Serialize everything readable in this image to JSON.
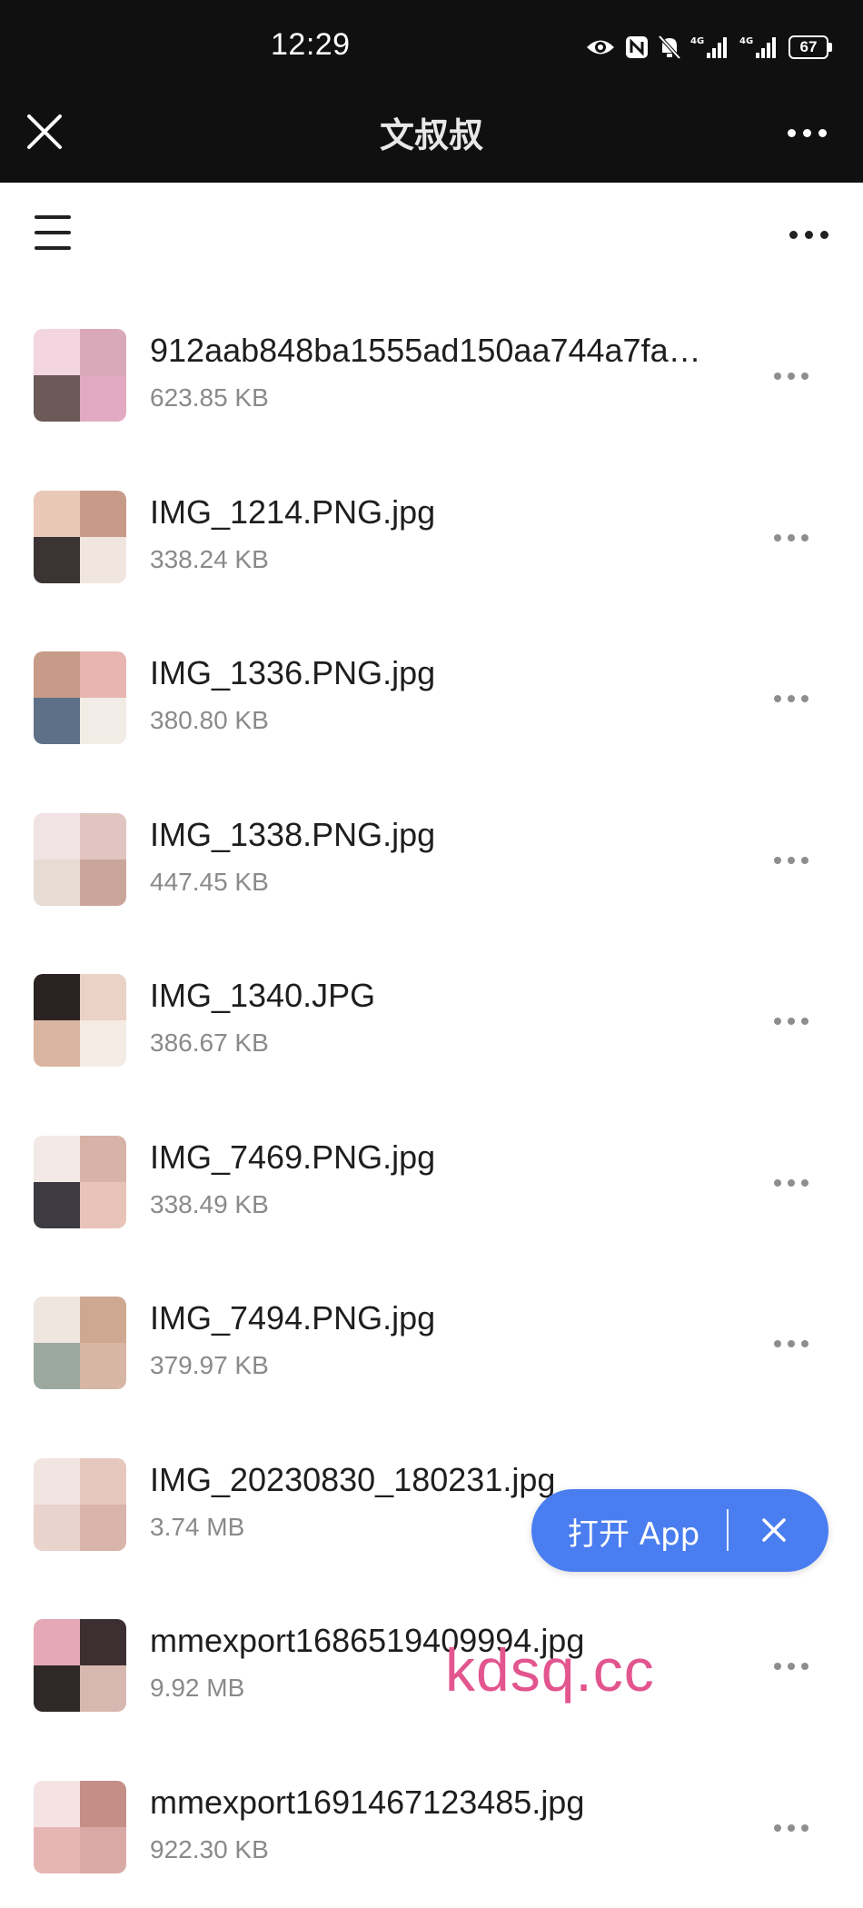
{
  "status_bar": {
    "time": "12:29",
    "battery": "67",
    "icons": [
      "eye-icon",
      "nfc-icon",
      "mute-icon",
      "signal-4g-icon",
      "signal-4g-icon",
      "battery-icon"
    ]
  },
  "header": {
    "title": "文叔叔",
    "close_icon": "close-icon",
    "more_icon": "more-icon"
  },
  "toolbar": {
    "menu_icon": "menu-icon",
    "more_icon": "more-icon"
  },
  "files": [
    {
      "name": "912aab848ba1555ad150aa744a7fa…",
      "size": "623.85 KB",
      "colors": [
        "#f3d6df",
        "#d9a8b9",
        "#6b5a57",
        "#e2a9c2"
      ]
    },
    {
      "name": "IMG_1214.PNG.jpg",
      "size": "338.24 KB",
      "colors": [
        "#e9c8b7",
        "#c89a8a",
        "#3c3434",
        "#f1e6df"
      ]
    },
    {
      "name": "IMG_1336.PNG.jpg",
      "size": "380.80 KB",
      "colors": [
        "#c79b87",
        "#e8b5b0",
        "#5d7087",
        "#f2ece6"
      ]
    },
    {
      "name": "IMG_1338.PNG.jpg",
      "size": "447.45 KB",
      "colors": [
        "#f1e2e4",
        "#e0c5c1",
        "#e7dcd4",
        "#caa59a"
      ]
    },
    {
      "name": "IMG_1340.JPG",
      "size": "386.67 KB",
      "colors": [
        "#2b2322",
        "#ebd2c6",
        "#d9b59f",
        "#f4ece4"
      ]
    },
    {
      "name": "IMG_7469.PNG.jpg",
      "size": "338.49 KB",
      "colors": [
        "#f3e9e6",
        "#d6b3a6",
        "#3d3a42",
        "#e8c3b8"
      ]
    },
    {
      "name": "IMG_7494.PNG.jpg",
      "size": "379.97 KB",
      "colors": [
        "#efe6e0",
        "#cfa891",
        "#9ba9a1",
        "#d7b6a5"
      ]
    },
    {
      "name": "IMG_20230830_180231.jpg",
      "size": "3.74 MB",
      "colors": [
        "#f2e4e0",
        "#e6c7bd",
        "#e9d3cc",
        "#d9b4ab"
      ]
    },
    {
      "name": "mmexport1686519409994.jpg",
      "size": "9.92 MB",
      "colors": [
        "#e6a8b6",
        "#3b2f31",
        "#2e2829",
        "#d7b8b0"
      ]
    },
    {
      "name": "mmexport1691467123485.jpg",
      "size": "922.30 KB",
      "colors": [
        "#f5e3e3",
        "#c58f87",
        "#e5b6b4",
        "#d9aaa5"
      ]
    }
  ],
  "open_app": {
    "label": "打开 App",
    "close_icon": "close-icon"
  },
  "watermark": "kdsq.cc"
}
